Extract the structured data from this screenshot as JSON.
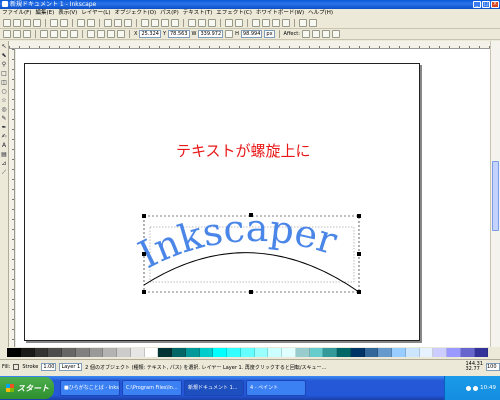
{
  "window": {
    "title": "新規ドキュメント 1 - Inkscape",
    "controls": [
      "_",
      "□",
      "×"
    ]
  },
  "menu": [
    "ファイル(F)",
    "編集(E)",
    "表示(V)",
    "レイヤー(L)",
    "オブジェクト(O)",
    "パス(P)",
    "テキスト(T)",
    "エフェクト(C)",
    "ホワイトボード(W)",
    "ヘルプ(H)"
  ],
  "toolbar": {
    "x_label": "X",
    "x_value": "25.324",
    "y_label": "Y",
    "y_value": "78.563",
    "w_label": "W",
    "w_value": "339.972",
    "h_label": "H",
    "h_value": "98.994",
    "unit": "px",
    "affect_label": "Affect:"
  },
  "tools": [
    "select-icon",
    "node-icon",
    "zoom-icon",
    "rect-icon",
    "3dbox-icon",
    "ellipse-icon",
    "star-icon",
    "spiral-icon",
    "pencil-icon",
    "pen-icon",
    "calligraphy-icon",
    "text-icon",
    "gradient-icon",
    "dropper-icon",
    "connector-icon"
  ],
  "tool_glyphs": [
    "↖",
    "⬉",
    "⚲",
    "□",
    "◫",
    "○",
    "☆",
    "◎",
    "✎",
    "✒",
    "✍",
    "A",
    "▤",
    "⊿",
    "⟋"
  ],
  "canvas": {
    "heading_text": "テキストが螺旋上に",
    "heading_color": "#e81818",
    "curved_text": "Inkscaper",
    "curved_text_color": "#4a86e8"
  },
  "palette": [
    "#000000",
    "#1a1a1a",
    "#333333",
    "#4d4d4d",
    "#666666",
    "#808080",
    "#999999",
    "#b3b3b3",
    "#cccccc",
    "#e6e6e6",
    "#ffffff",
    "#003333",
    "#006666",
    "#009999",
    "#00cccc",
    "#00ffff",
    "#33ffff",
    "#66ffff",
    "#99ffff",
    "#ccffff",
    "#e0ffff",
    "#99cccc",
    "#66cccc",
    "#339999",
    "#006666",
    "#003366",
    "#336699",
    "#6699cc",
    "#99ccff",
    "#cce6ff",
    "#e6f2ff",
    "#ccccff",
    "#9999ff",
    "#6666cc",
    "#333399"
  ],
  "status": {
    "fill_label": "Fill:",
    "stroke_label": "Stroke",
    "stroke_width": "1.00",
    "layer": "Layer 1",
    "message": "2 個のオブジェクト (種類: テキスト, パス) を選択. レイヤー Layer 1. 再度クリックすると回転/スキュー…",
    "coord_x": "144.31",
    "coord_y": "32.77",
    "zoom": "100"
  },
  "taskbar": {
    "start_label": "スタート",
    "buttons": [
      "■ひらがなことば - Inkscape",
      "C:\\Program Files\\In...",
      "新規ドキュメント 1...",
      "4 - ペイント"
    ],
    "active_index": 2,
    "clock": "10:49"
  }
}
